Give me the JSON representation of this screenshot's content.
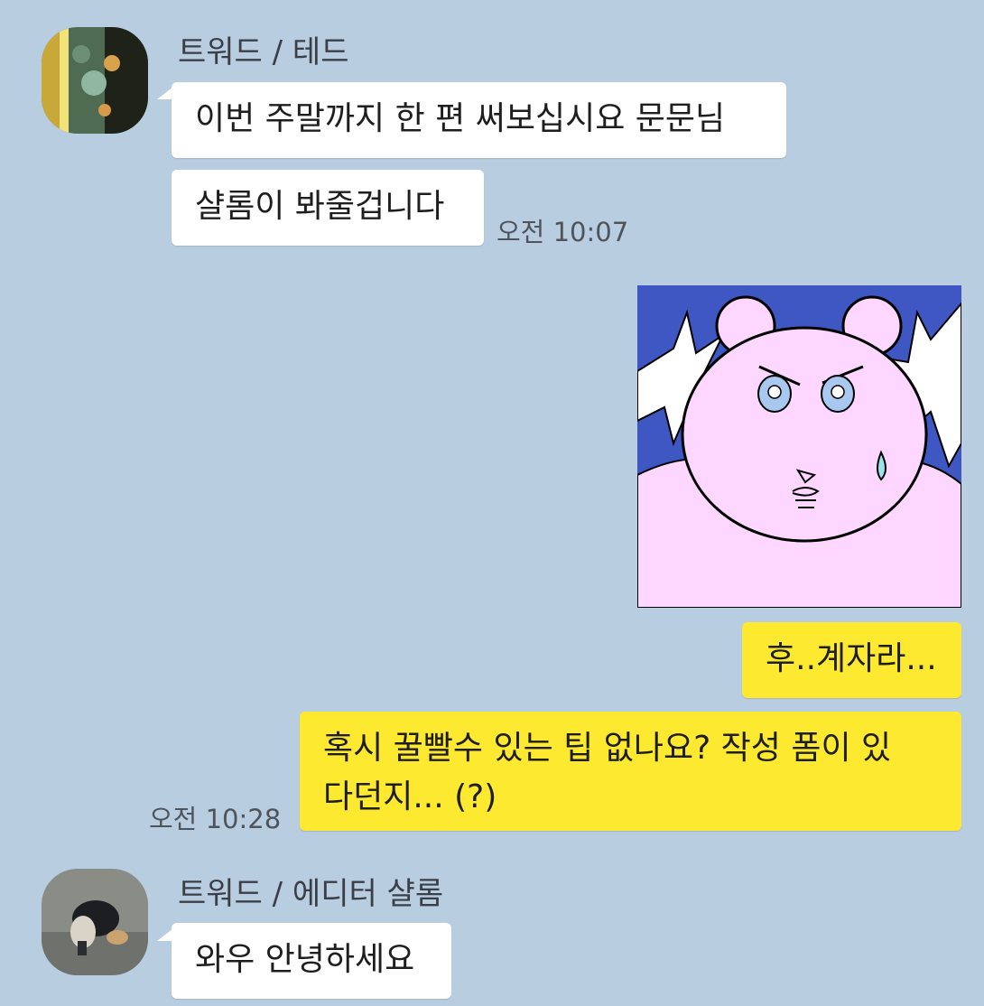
{
  "colors": {
    "background": "#b9cde0",
    "incoming_bubble": "#ffffff",
    "outgoing_bubble": "#fde92f"
  },
  "messages": {
    "group1": {
      "sender": "트워드 / 테드",
      "avatar_icon": "profile-photo",
      "msg1": "이번 주말까지 한 편 써보십시요 문문님",
      "msg2": "샬롬이 봐줄겁니다",
      "time": "오전 10:07"
    },
    "outgoing": {
      "sticker_icon": "angry-pink-bear-sticker",
      "msg1": "후..계자라...",
      "msg2_line1": "혹시 꿀빨수 있는 팁 없나요? 작성 폼이 있",
      "msg2_line2": "다던지... (?)",
      "time": "오전 10:28"
    },
    "group2": {
      "sender": "트워드 / 에디터 샬롬",
      "avatar_icon": "profile-photo",
      "msg1": "와우 안녕하세요"
    }
  }
}
